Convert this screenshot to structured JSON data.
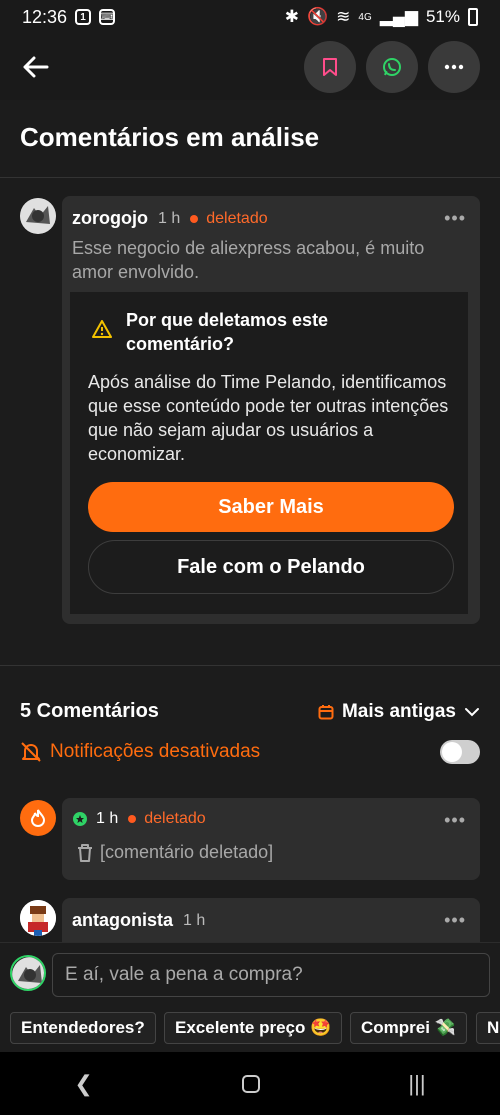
{
  "status_bar": {
    "time": "12:36",
    "battery": "51%",
    "network": "4G"
  },
  "header": {
    "title": "Comentários em análise"
  },
  "review_comment": {
    "user": "zorogojo",
    "time": "1 h",
    "status": "deletado",
    "text": "Esse negocio de aliexpress acabou, é muito amor envolvido.",
    "why_title": "Por que deletamos este comentário?",
    "why_body": "Após análise do Time Pelando, identificamos que esse conteúdo pode ter outras intenções que não sejam ajudar os usuários a economizar.",
    "primary_button": "Saber Mais",
    "secondary_button": "Fale com o Pelando"
  },
  "comments_section": {
    "title": "5 Comentários",
    "sort_label": "Mais antigas",
    "notifications_label": "Notificações desativadas",
    "notifications_enabled": false
  },
  "comments": [
    {
      "user": "",
      "time": "1 h",
      "status": "deletado",
      "text": "[comentário deletado]"
    },
    {
      "user": "antagonista",
      "time": "1 h"
    }
  ],
  "composer": {
    "placeholder": "E aí, vale a pena a compra?"
  },
  "quick_replies": [
    "Entendedores?",
    "Excelente preço 🤩",
    "Comprei 💸",
    "N"
  ],
  "colors": {
    "accent": "#ff6c0f",
    "background": "#1c1c1c",
    "card": "#2e2e2e"
  }
}
